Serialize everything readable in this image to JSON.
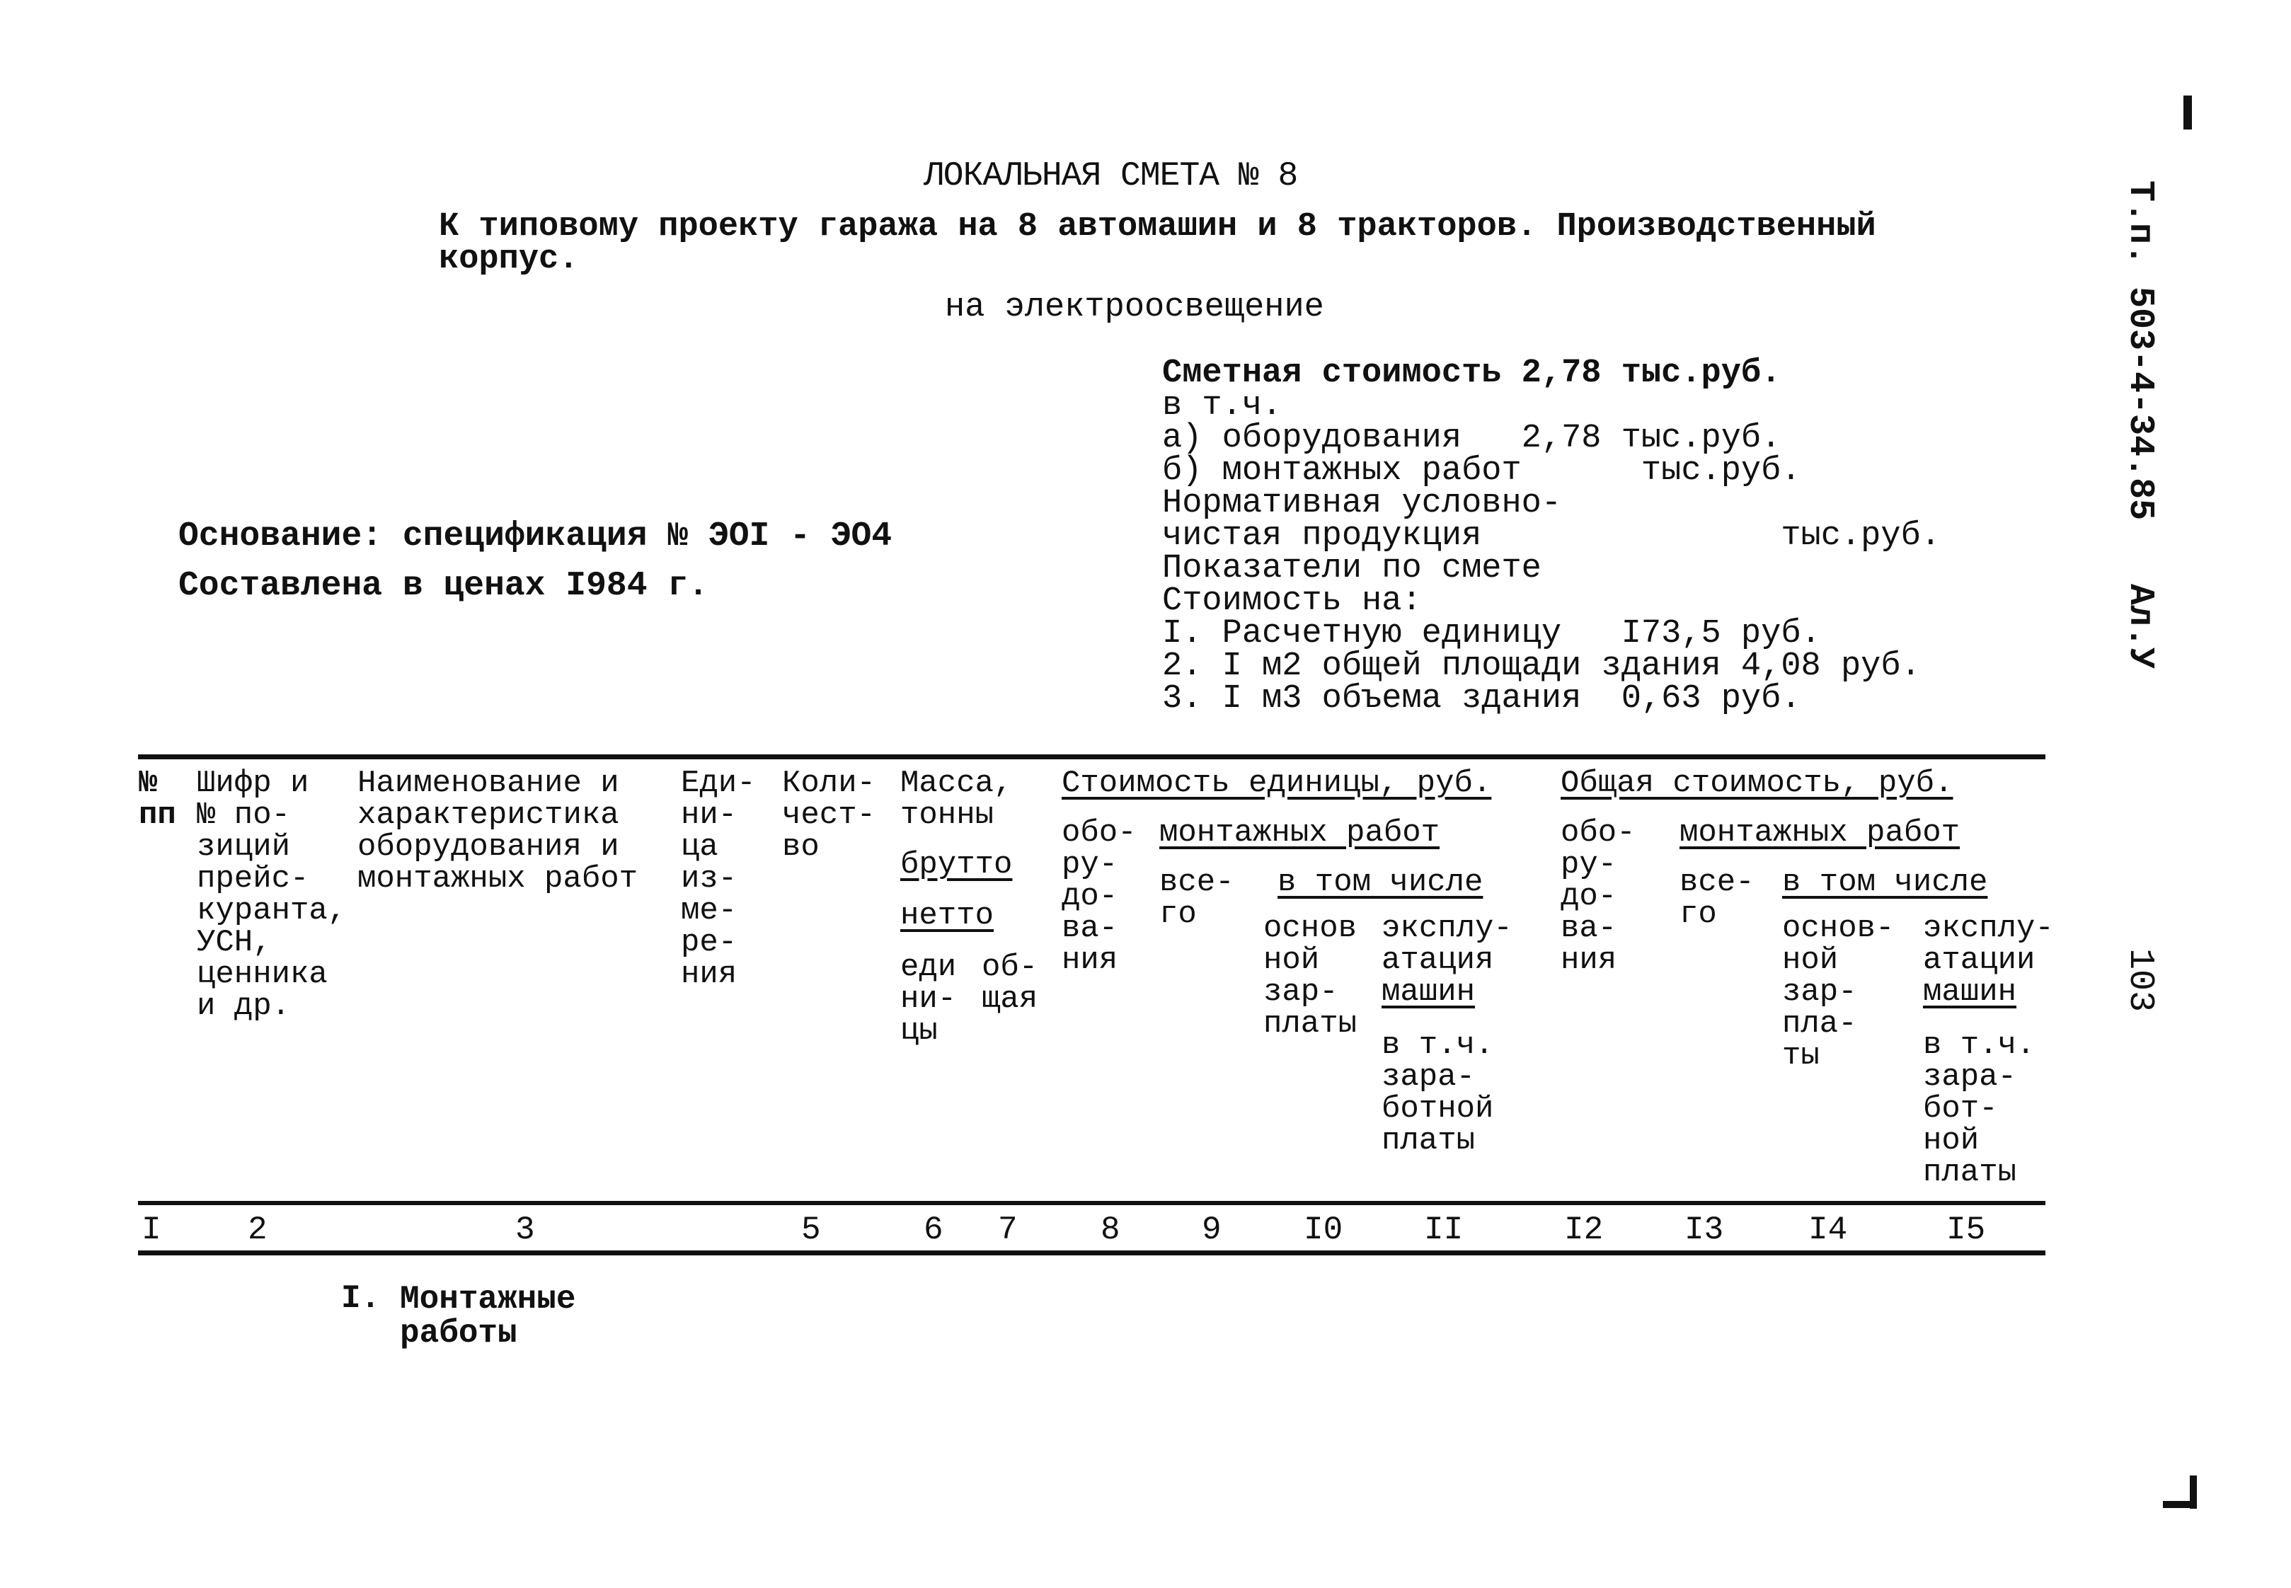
{
  "document": {
    "title": "ЛОКАЛЬНАЯ СМЕТА № 8",
    "subtitle_line1": "К типовому проекту гаража на 8 автомашин и 8 тракторов. Производственный",
    "subtitle_line2": "корпус.",
    "purpose": "на электроосвещение"
  },
  "margin": {
    "project_code": "Т.п. 503-4-34.85",
    "album": "Ал.У",
    "page_number": "103",
    "top_mark": "|"
  },
  "basis": {
    "line1": "Основание: спецификация № ЭОI - ЭО4",
    "line2": "Составлена в ценах I984 г."
  },
  "summary": {
    "lines": [
      "Сметная стоимость 2,78 тыс.руб.",
      "в т.ч.",
      "а) оборудования   2,78 тыс.руб.",
      "б) монтажных работ      тыс.руб.",
      "Нормативная условно-",
      "чистая продукция               тыс.руб.",
      "Показатели по смете",
      "Стоимость на:",
      "I. Расчетную единицу   I73,5 руб.",
      "2. I м2 общей площади здания 4,08 руб.",
      "3. I м3 объема здания  0,63 руб."
    ],
    "estimated_cost": "2,78",
    "equipment_cost": "2,78",
    "unit_cost": "I73,5",
    "cost_per_m2": "4,08",
    "cost_per_m3": "0,63"
  },
  "table": {
    "headers": {
      "c1": "№\nпп",
      "c2": "Шифр и\n№ по-\nзиций\nпрейс-\nкуранта,\nУСН,\nценника\nи др.",
      "c3": "Наименование и\nхарактеристика\nоборудования и\nмонтажных работ",
      "c4": "Еди-\nни-\nца\nиз-\nме-\nре-\nния",
      "c5": "Коли-\nчест-\nво",
      "c6_top": "Масса,\nтонны",
      "c6_brutto": "брутто",
      "c6_netto": "нетто",
      "c6_unit": "еди\nни-\nцы",
      "c7_total": "об-\nщая",
      "unit_cost_group": "Стоимость единицы, руб.",
      "total_cost_group": "Общая стоимость, руб.",
      "equipment": "обо-\nру-\nдо-\nва-\nния",
      "install_group": "монтажных работ",
      "total": "все-\nго",
      "incl": "в том числе",
      "base_wage_a": "основ\nной\nзар-\nплаты",
      "base_wage_b": "основ-\nной\nзар-\nпла-\nты",
      "machine_op_a": "эксплу-\nатация",
      "machine_op_b": "эксплу-\nатации",
      "machines": "машин",
      "incl_wage_a": "в т.ч.\nзара-\nботной\nплаты",
      "incl_wage_b": "в т.ч.\nзара-\nбот-\nной\nплаты"
    },
    "column_numbers": [
      "I",
      "2",
      "3",
      "5",
      "6",
      "7",
      "8",
      "9",
      "I0",
      "II",
      "I2",
      "I3",
      "I4",
      "I5"
    ],
    "sections": [
      {
        "number": "I.",
        "title": "Монтажные\nработы"
      }
    ]
  }
}
